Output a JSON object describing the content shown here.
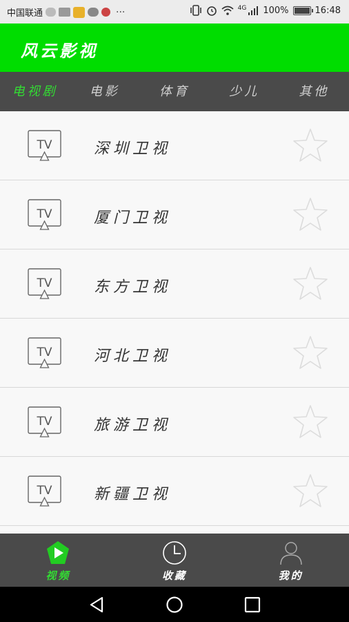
{
  "status_bar": {
    "carrier": "中国联通",
    "network": "4G",
    "battery_text": "100%",
    "battery_level": 1.0,
    "time": "16:48",
    "overflow": "···"
  },
  "app_bar": {
    "title": "风云影视"
  },
  "tabs": [
    {
      "label": "电视剧",
      "active": true
    },
    {
      "label": "电影",
      "active": false
    },
    {
      "label": "体育",
      "active": false
    },
    {
      "label": "少儿",
      "active": false
    },
    {
      "label": "其他",
      "active": false
    }
  ],
  "channels": [
    {
      "icon_text": "TV",
      "name": "深圳卫视"
    },
    {
      "icon_text": "TV",
      "name": "厦门卫视"
    },
    {
      "icon_text": "TV",
      "name": "东方卫视"
    },
    {
      "icon_text": "TV",
      "name": "河北卫视"
    },
    {
      "icon_text": "TV",
      "name": "旅游卫视"
    },
    {
      "icon_text": "TV",
      "name": "新疆卫视"
    }
  ],
  "bottom_nav": [
    {
      "label": "视频",
      "icon": "play-icon",
      "active": true
    },
    {
      "label": "收藏",
      "icon": "clock-icon",
      "active": false
    },
    {
      "label": "我的",
      "icon": "user-icon",
      "active": false
    }
  ],
  "colors": {
    "accent": "#00dd00",
    "active_text": "#33dd33",
    "dark_bar": "#4a4a4a"
  }
}
